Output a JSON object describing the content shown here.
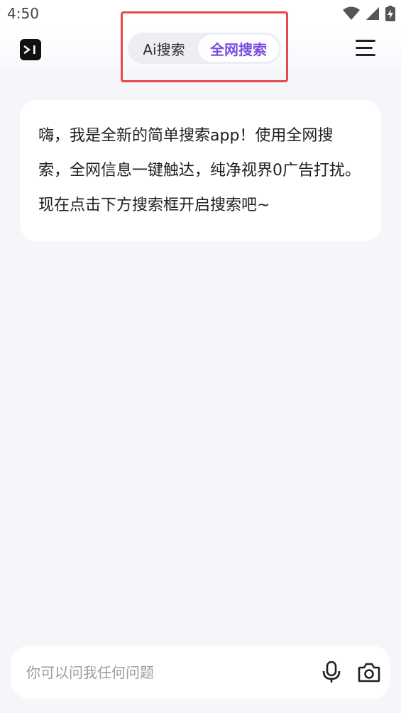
{
  "status_bar": {
    "time": "4:50",
    "icons": [
      "wifi-icon",
      "signal-icon",
      "battery-charging-icon"
    ]
  },
  "header": {
    "logo_icon": "terminal-logo-icon",
    "tabs": [
      {
        "label": "Ai搜索",
        "active": false
      },
      {
        "label": "全网搜索",
        "active": true
      }
    ],
    "menu_icon": "hamburger-menu-icon",
    "accent_color": "#7b4de0",
    "highlight_frame_color": "#e5484d"
  },
  "chat": {
    "welcome_message": "嗨，我是全新的简单搜索app！使用全网搜索，全网信息一键触达，纯净视界0广告打扰。现在点击下方搜索框开启搜索吧~"
  },
  "search": {
    "placeholder": "你可以问我任何问题",
    "value": "",
    "mic_icon": "microphone-icon",
    "camera_icon": "camera-icon"
  }
}
